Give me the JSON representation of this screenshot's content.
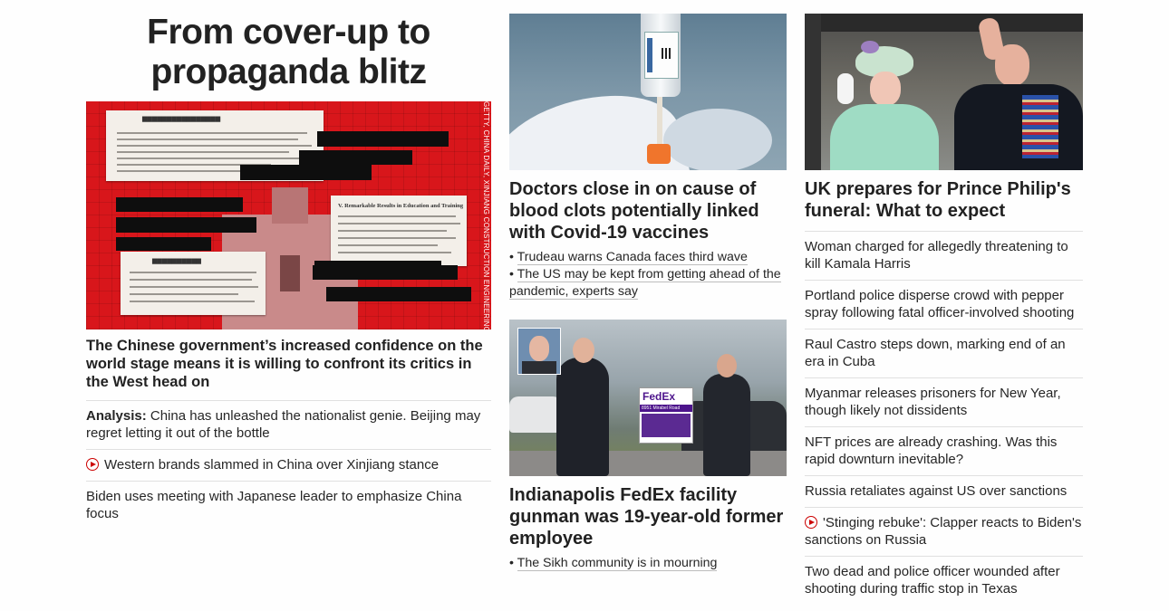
{
  "column1": {
    "banner": [
      "From cover-up to",
      "propaganda blitz"
    ],
    "image": {
      "alt": "Collage of redacted Chinese government documents on red grid background",
      "credit": "GETTY, CHINA DAILY, XINJIANG CONSTRUCTION ENGINEERING",
      "document_heading": "V. Remarkable Results in Education and Training"
    },
    "headline": "The Chinese government’s increased confidence on the world stage means it is willing to confront its critics in the West head on",
    "list": [
      {
        "prefix": "Analysis:",
        "text": " China has unleashed the nationalist genie. Beijing may regret letting it out of the bottle",
        "video": false
      },
      {
        "prefix": "",
        "text": "Western brands slammed in China over Xinjiang stance",
        "video": true
      },
      {
        "prefix": "",
        "text": "Biden uses meeting with Japanese leader to emphasize China focus",
        "video": false
      }
    ]
  },
  "column2": {
    "card1": {
      "image": {
        "alt": "Gloved hand holding Covid-19 vaccine vial and syringe"
      },
      "headline": "Doctors close in on cause of blood clots potentially linked with Covid-19 vaccines",
      "related": [
        "Trudeau warns Canada faces third wave",
        "The US may be kept from getting ahead of the pandemic, experts say"
      ]
    },
    "card2": {
      "image": {
        "alt": "Police officers outside FedEx facility in Indianapolis",
        "sign_brand": "FedEx",
        "sign_address": "8951 Mirabel Road"
      },
      "headline": "Indianapolis FedEx facility gunman was 19-year-old former employee",
      "related": [
        "The Sikh community is in mourning"
      ]
    }
  },
  "column3": {
    "card": {
      "image": {
        "alt": "Queen Elizabeth and Prince Philip waving from a balcony"
      },
      "headline": "UK prepares for Prince Philip's funeral: What to expect"
    },
    "list": [
      {
        "text": "Woman charged for allegedly threatening to kill Kamala Harris",
        "video": false
      },
      {
        "text": "Portland police disperse crowd with pepper spray following fatal officer-involved shooting",
        "video": false
      },
      {
        "text": "Raul Castro steps down, marking end of an era in Cuba",
        "video": false
      },
      {
        "text": "Myanmar releases prisoners for New Year, though likely not dissidents",
        "video": false
      },
      {
        "text": "NFT prices are already crashing. Was this rapid downturn inevitable?",
        "video": false
      },
      {
        "text": "Russia retaliates against US over sanctions",
        "video": false
      },
      {
        "text": "'Stinging rebuke': Clapper reacts to Biden's sanctions on Russia",
        "video": true
      },
      {
        "text": "Two dead and police officer wounded after shooting during traffic stop in Texas",
        "video": false
      }
    ]
  },
  "colors": {
    "accent_red": "#cc0000",
    "hero_red": "#d8161b",
    "text": "#262626",
    "divider": "#e0e0e0"
  }
}
